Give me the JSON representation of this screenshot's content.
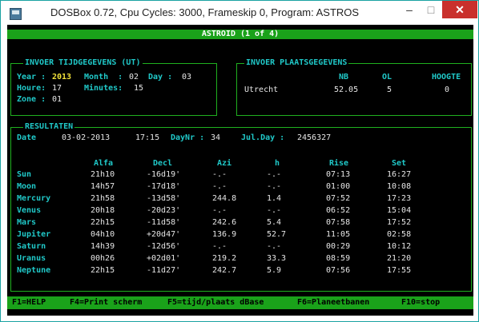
{
  "window": {
    "title": "DOSBox 0.72, Cpu Cycles:    3000, Frameskip  0, Program:  ASTROS",
    "min_glyph": "–",
    "max_glyph": "□",
    "close_glyph": "✕"
  },
  "screen": {
    "header": "ASTROID (1 of 4)",
    "time_box": {
      "legend": "INVOER TIJDGEGEVENS (UT)",
      "year_label": "Year :",
      "year": "2013",
      "month_label": "Month  :",
      "month": "02",
      "day_label": "Day :",
      "day": "03",
      "hours_label": "Houre:",
      "hours": "17",
      "minutes_label": "Minutes:",
      "minutes": "15",
      "zone_label": "Zone :",
      "zone": "01"
    },
    "place_box": {
      "legend": "INVOER PLAATSGEGEVENS",
      "col_nb": "NB",
      "col_ol": "OL",
      "col_hoogte": "HOOGTE",
      "place": "Utrecht",
      "nb": "52.05",
      "ol": "5",
      "hoogte": "0"
    },
    "results": {
      "legend": "RESULTATEN",
      "date_label": "Date",
      "date": "03-02-2013",
      "time": "17:15",
      "daynr_label": "DayNr :",
      "daynr": "34",
      "julday_label": "Jul.Day :",
      "julday": "2456327",
      "headers": [
        "Alfa",
        "Decl",
        "Azi",
        "h",
        "Rise",
        "Set"
      ],
      "rows": [
        {
          "name": "Sun",
          "alfa": "21h10",
          "decl": "-16d19'",
          "azi": "-.-",
          "h": "-.-",
          "rise": "07:13",
          "set": "16:27"
        },
        {
          "name": "Moon",
          "alfa": "14h57",
          "decl": "-17d18'",
          "azi": "-.-",
          "h": "-.-",
          "rise": "01:00",
          "set": "10:08"
        },
        {
          "name": "Mercury",
          "alfa": "21h58",
          "decl": "-13d58'",
          "azi": "244.8",
          "h": "1.4",
          "rise": "07:52",
          "set": "17:23"
        },
        {
          "name": "Venus",
          "alfa": "20h18",
          "decl": "-20d23'",
          "azi": "-.-",
          "h": "-.-",
          "rise": "06:52",
          "set": "15:04"
        },
        {
          "name": "Mars",
          "alfa": "22h15",
          "decl": "-11d58'",
          "azi": "242.6",
          "h": "5.4",
          "rise": "07:58",
          "set": "17:52"
        },
        {
          "name": "Jupiter",
          "alfa": "04h10",
          "decl": "+20d47'",
          "azi": "136.9",
          "h": "52.7",
          "rise": "11:05",
          "set": "02:58"
        },
        {
          "name": "Saturn",
          "alfa": "14h39",
          "decl": "-12d56'",
          "azi": "-.-",
          "h": "-.-",
          "rise": "00:29",
          "set": "10:12"
        },
        {
          "name": "Uranus",
          "alfa": "00h26",
          "decl": "+02d01'",
          "azi": "219.2",
          "h": "33.3",
          "rise": "08:59",
          "set": "21:20"
        },
        {
          "name": "Neptune",
          "alfa": "22h15",
          "decl": "-11d27'",
          "azi": "242.7",
          "h": "5.9",
          "rise": "07:56",
          "set": "17:55"
        }
      ]
    },
    "fkeys": [
      "F1=HELP",
      "F4=Print scherm",
      "F5=tijd/plaats dBase",
      "F6=Planeetbanen",
      "F10=stop"
    ]
  },
  "colors": {
    "screen_bg": "#000000",
    "cyan_text": "#20c9c9",
    "green_bar": "#1aa21a",
    "close_button": "#c9302c",
    "highlight_yellow": "#f2e23a"
  }
}
